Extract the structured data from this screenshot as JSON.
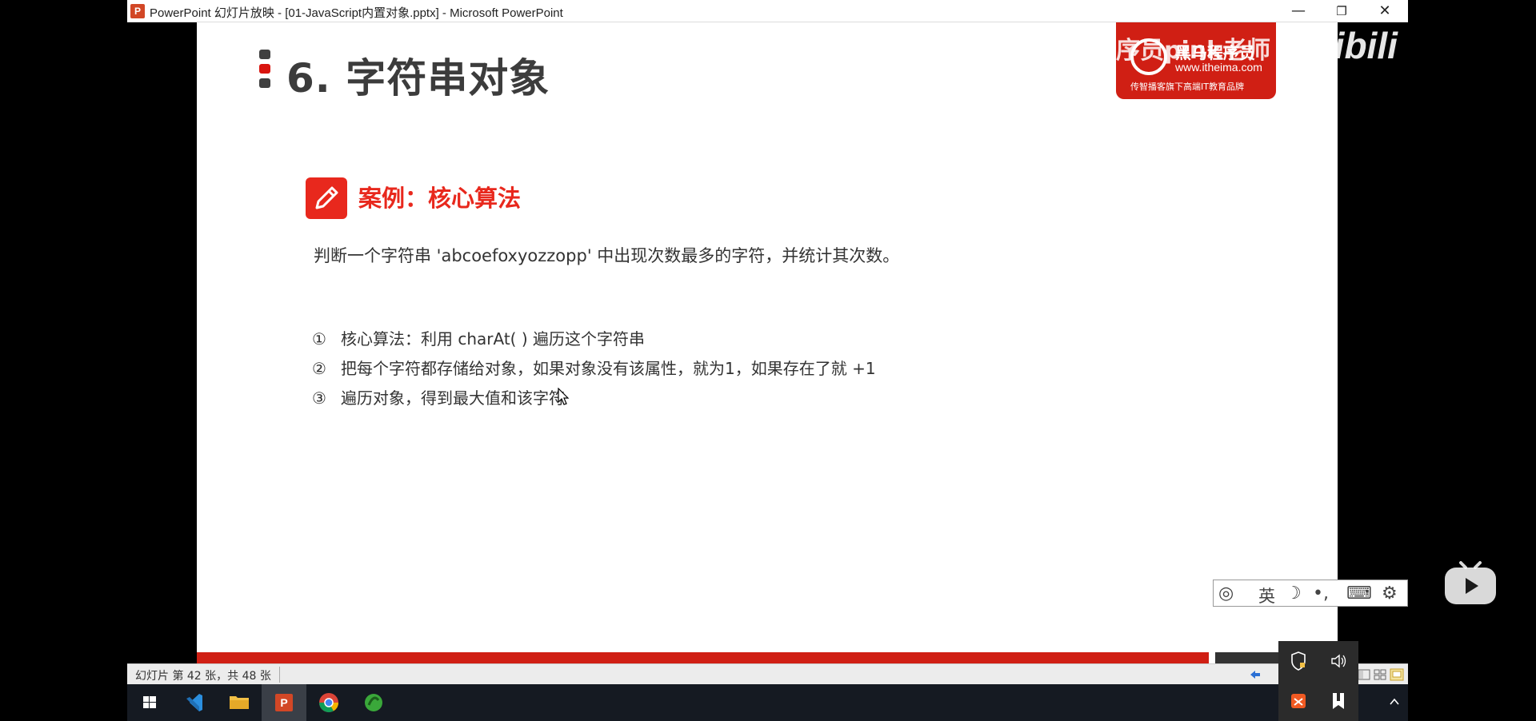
{
  "window": {
    "title": "PowerPoint 幻灯片放映 - [01-JavaScript内置对象.pptx] - Microsoft PowerPoint",
    "app_icon_letter": "P",
    "minimize_label": "—",
    "restore_label": "❐",
    "close_label": "✕"
  },
  "slide": {
    "title": "6. 字符串对象",
    "logo": {
      "brand": "黑马程序员",
      "url": "www.itheima.com",
      "slogan": "传智播客旗下高端IT教育品牌"
    },
    "case_title": "案例：核心算法",
    "question": "判断一个字符串 'abcoefoxyozzopp' 中出现次数最多的字符，并统计其次数。",
    "steps": [
      {
        "num": "①",
        "text": "核心算法：利用 charAt( ) 遍历这个字符串"
      },
      {
        "num": "②",
        "text": "把每个字符都存储给对象，如果对象没有该属性，就为1，如果存在了就 +1"
      },
      {
        "num": "③",
        "text": "遍历对象，得到最大值和该字符"
      }
    ]
  },
  "overlay": {
    "watermark": "黑马程序员pink老师",
    "bili_logo": "bilibili"
  },
  "ime": {
    "mode": "英"
  },
  "statusbar": {
    "slide_info": "幻灯片 第 42 张，共 48 张"
  },
  "taskbar": {
    "items": [
      "windows-start",
      "vscode",
      "file-explorer",
      "powerpoint",
      "chrome",
      "app-green"
    ],
    "active": "powerpoint"
  },
  "colors": {
    "accent_red": "#e8281d",
    "title_gray": "#3c3c3c",
    "taskbar": "#151a22"
  }
}
